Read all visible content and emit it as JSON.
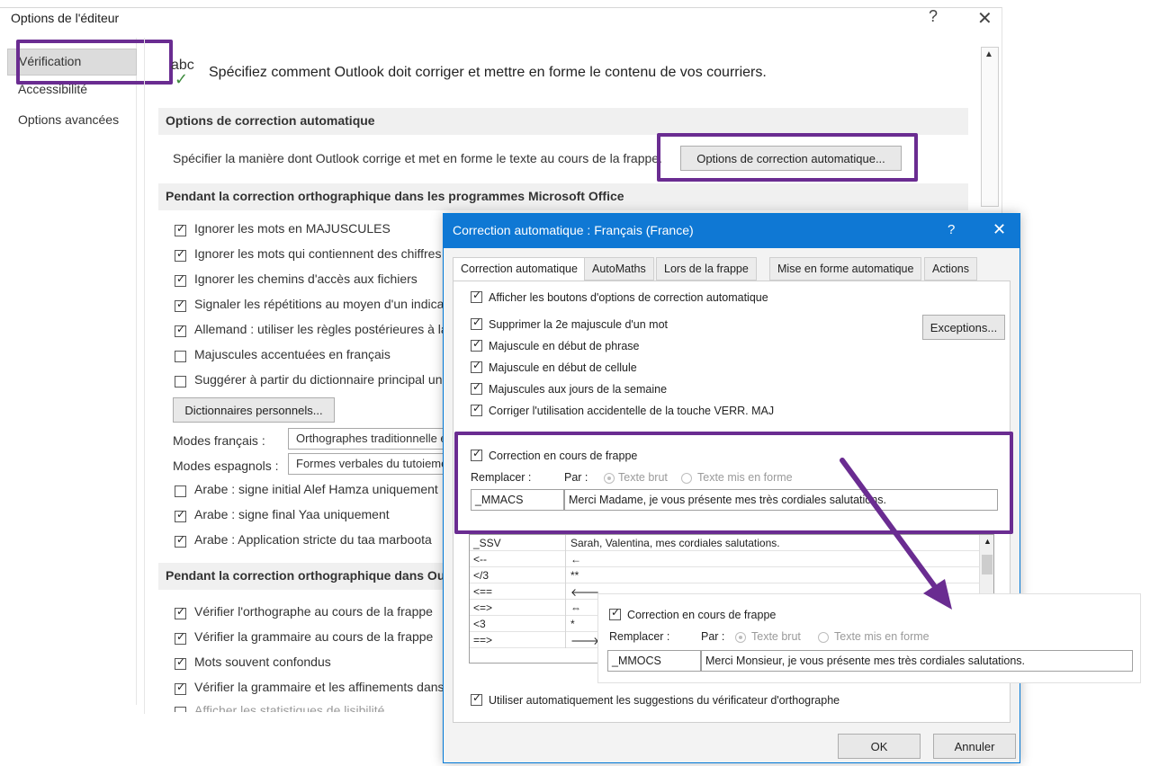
{
  "window": {
    "title": "Options de l'éditeur",
    "help": "?",
    "close": "✕"
  },
  "sidebar": {
    "items": [
      {
        "label": "Vérification"
      },
      {
        "label": "Accessibilité"
      },
      {
        "label": "Options avancées"
      }
    ]
  },
  "main": {
    "abc": "abc",
    "header": "Spécifiez comment Outlook doit corriger et mettre en forme le contenu de vos courriers.",
    "section1": "Options de correction automatique",
    "section1_desc": "Spécifier la manière dont Outlook corrige et met en forme le texte au cours de la frappe.",
    "autocorrect_btn": "Options de correction automatique...",
    "section2": "Pendant la correction orthographique dans les programmes Microsoft Office",
    "checks": [
      {
        "label": "Ignorer les mots en MAJUSCULES",
        "checked": true
      },
      {
        "label": "Ignorer les mots qui contiennent des chiffres",
        "checked": true
      },
      {
        "label": "Ignorer les chemins d'accès aux fichiers",
        "checked": true
      },
      {
        "label": "Signaler les répétitions au moyen d'un indicateur",
        "checked": true
      },
      {
        "label": "Allemand : utiliser les règles postérieures à la réforme",
        "checked": true
      },
      {
        "label": "Majuscules accentuées en français",
        "checked": false
      },
      {
        "label": "Suggérer à partir du dictionnaire principal uniquement",
        "checked": false
      }
    ],
    "dict_btn": "Dictionnaires personnels...",
    "modes_fr_label": "Modes français :",
    "modes_fr_value": "Orthographes traditionnelle et nouvelle",
    "modes_es_label": "Modes espagnols :",
    "modes_es_value": "Formes verbales du tutoiement et du voussoiement",
    "arabic": [
      {
        "label": "Arabe : signe initial Alef Hamza uniquement",
        "checked": false
      },
      {
        "label": "Arabe : signe final Yaa uniquement",
        "checked": true
      },
      {
        "label": "Arabe : Application stricte du taa marboota",
        "checked": true
      }
    ],
    "section3": "Pendant la correction orthographique dans Outlook",
    "outlook_checks": [
      {
        "label": "Vérifier l'orthographe au cours de la frappe",
        "checked": true
      },
      {
        "label": "Vérifier la grammaire au cours de la frappe",
        "checked": true
      },
      {
        "label": "Mots souvent confondus",
        "checked": true
      },
      {
        "label": "Vérifier la grammaire et les affinements dans le volet Éditeur",
        "checked": true
      },
      {
        "label": "Afficher les statistiques de lisibilité",
        "checked": false
      }
    ]
  },
  "dialog": {
    "title": "Correction automatique : Français (France)",
    "help": "?",
    "close": "✕",
    "tabs": [
      "Correction automatique",
      "AutoMaths",
      "Lors de la frappe",
      "Mise en forme automatique",
      "Actions"
    ],
    "show_buttons": "Afficher les boutons d'options de correction automatique",
    "exceptions_btn": "Exceptions...",
    "opts": [
      "Supprimer la 2e majuscule d'un mot",
      "Majuscule en début de phrase",
      "Majuscule en début de cellule",
      "Majuscules aux jours de la semaine",
      "Corriger l'utilisation accidentelle de la touche VERR. MAJ"
    ],
    "replace_check": "Correction en cours de frappe",
    "replace_label": "Remplacer :",
    "with_label": "Par :",
    "plain_text": "Texte brut",
    "formatted_text": "Texte mis en forme",
    "replace_value": "_MMACS",
    "with_value": "Merci Madame, je vous présente mes très cordiales salutations.",
    "list": [
      {
        "k": "_SSV",
        "v": "Sarah, Valentina, mes cordiales salutations."
      },
      {
        "k": "<--",
        "v": "←"
      },
      {
        "k": "</3",
        "v": "**"
      },
      {
        "k": "<==",
        "v": "🡐"
      },
      {
        "k": "<=>",
        "v": "⇔"
      },
      {
        "k": "<3",
        "v": "*"
      },
      {
        "k": "==>",
        "v": "🡒"
      }
    ],
    "use_suggestions": "Utiliser automatiquement les suggestions du vérificateur d'orthographe",
    "ok": "OK",
    "cancel": "Annuler"
  },
  "zoom": {
    "replace_check": "Correction en cours de frappe",
    "replace_label": "Remplacer :",
    "with_label": "Par :",
    "plain_text": "Texte brut",
    "formatted_text": "Texte mis en forme",
    "replace_value": "_MMOCS",
    "with_value": "Merci Monsieur, je vous présente mes très cordiales salutations."
  },
  "colors": {
    "highlight": "#6a2c91",
    "titlebar": "#0f78d4"
  }
}
